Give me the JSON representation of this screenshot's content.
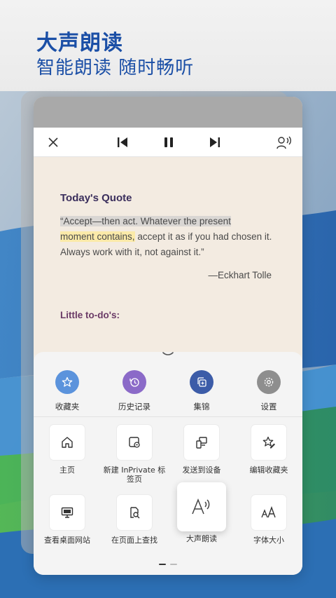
{
  "hero": {
    "title": "大声朗读",
    "subtitle": "智能朗读 随时畅听"
  },
  "toolbar": {
    "close_icon": "close-icon",
    "prev_icon": "skip-previous-icon",
    "pause_icon": "pause-icon",
    "next_icon": "skip-next-icon",
    "voice_icon": "voice-settings-icon"
  },
  "reader": {
    "heading": "Today's Quote",
    "quote_part1": "“Accept—then act. Whatever the present",
    "quote_part2": "moment contains,",
    "quote_part3": " accept it as if you had chosen it. Always work with it, not against it.”",
    "author": "—Eckhart Tolle",
    "todo_heading": "Little to-do's:"
  },
  "quick": [
    {
      "label": "收藏夹",
      "icon": "star-icon",
      "color": "#5b93dc"
    },
    {
      "label": "历史记录",
      "icon": "history-icon",
      "color": "#8b6ac8"
    },
    {
      "label": "集锦",
      "icon": "collections-icon",
      "color": "#3c5ca8"
    },
    {
      "label": "设置",
      "icon": "gear-icon",
      "color": "#8e8e8e"
    }
  ],
  "grid": [
    {
      "label": "主页",
      "icon": "home-icon"
    },
    {
      "label": "新建 InPrivate 标签页",
      "icon": "inprivate-tab-icon"
    },
    {
      "label": "发送到设备",
      "icon": "send-to-device-icon"
    },
    {
      "label": "编辑收藏夹",
      "icon": "edit-favorites-icon"
    },
    {
      "label": "查看桌面网站",
      "icon": "desktop-site-icon"
    },
    {
      "label": "在页面上查找",
      "icon": "find-on-page-icon"
    },
    {
      "label": "大声朗读",
      "icon": "read-aloud-icon"
    },
    {
      "label": "字体大小",
      "icon": "font-size-icon"
    }
  ]
}
